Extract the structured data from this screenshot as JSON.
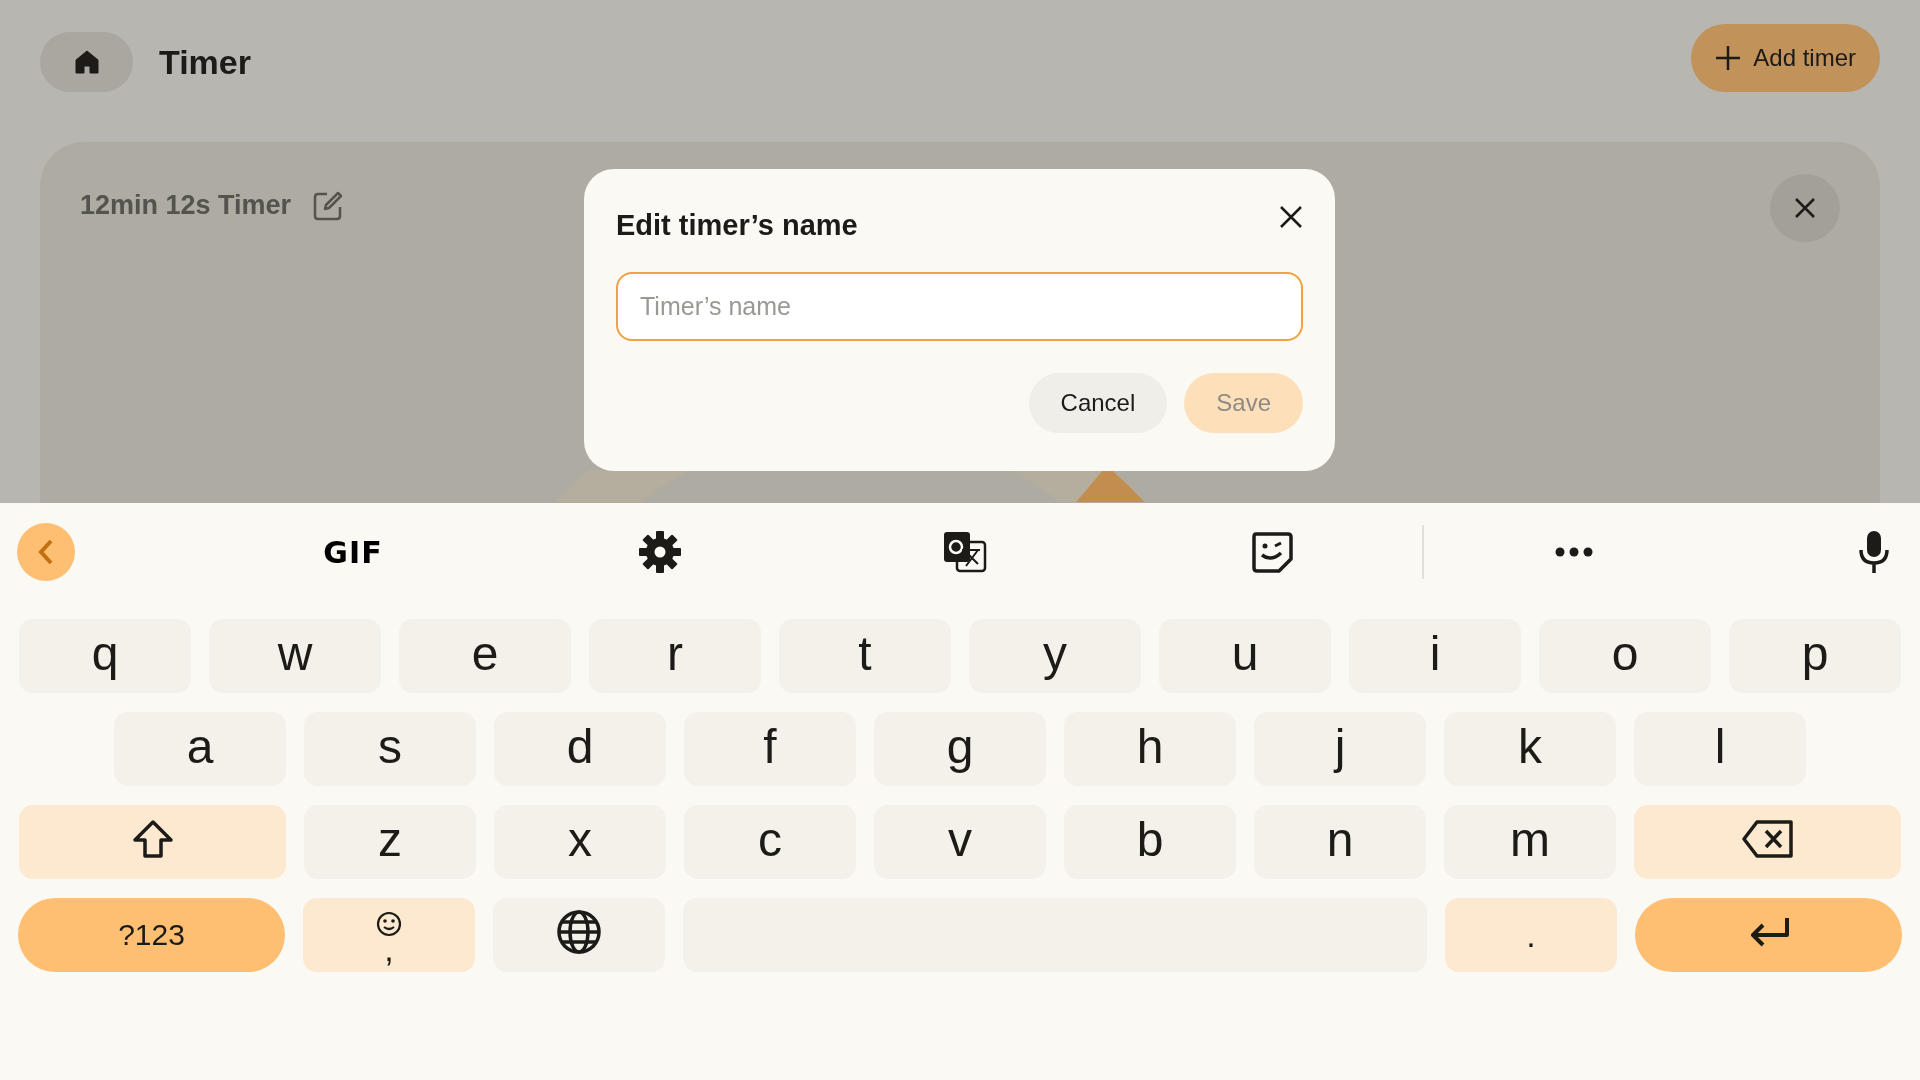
{
  "header": {
    "title": "Timer",
    "add_button": "Add timer"
  },
  "timer_card": {
    "title": "12min 12s Timer"
  },
  "dialog": {
    "title": "Edit timer’s name",
    "input": {
      "placeholder": "Timer’s name"
    },
    "buttons": [
      {
        "label": "Cancel",
        "kind": "secondary",
        "disabled": false
      },
      {
        "label": "Save",
        "kind": "primary",
        "disabled": true
      }
    ]
  },
  "keyboard": {
    "toolbar": [
      {
        "kind": "back"
      },
      {
        "kind": "gif",
        "label": "GIF"
      },
      {
        "kind": "settings"
      },
      {
        "kind": "translate"
      },
      {
        "kind": "sticker"
      },
      {
        "kind": "divider"
      },
      {
        "kind": "more"
      },
      {
        "kind": "mic"
      }
    ],
    "letter_rows": [
      [
        {
          "kind": "letter",
          "label": "q"
        },
        {
          "kind": "letter",
          "label": "w"
        },
        {
          "kind": "letter",
          "label": "e"
        },
        {
          "kind": "letter",
          "label": "r"
        },
        {
          "kind": "letter",
          "label": "t"
        },
        {
          "kind": "letter",
          "label": "y"
        },
        {
          "kind": "letter",
          "label": "u"
        },
        {
          "kind": "letter",
          "label": "i"
        },
        {
          "kind": "letter",
          "label": "o"
        },
        {
          "kind": "letter",
          "label": "p"
        }
      ],
      [
        {
          "kind": "letter",
          "label": "a"
        },
        {
          "kind": "letter",
          "label": "s"
        },
        {
          "kind": "letter",
          "label": "d"
        },
        {
          "kind": "letter",
          "label": "f"
        },
        {
          "kind": "letter",
          "label": "g"
        },
        {
          "kind": "letter",
          "label": "h"
        },
        {
          "kind": "letter",
          "label": "j"
        },
        {
          "kind": "letter",
          "label": "k"
        },
        {
          "kind": "letter",
          "label": "l"
        }
      ],
      [
        {
          "kind": "shift"
        },
        {
          "kind": "letter",
          "label": "z"
        },
        {
          "kind": "letter",
          "label": "x"
        },
        {
          "kind": "letter",
          "label": "c"
        },
        {
          "kind": "letter",
          "label": "v"
        },
        {
          "kind": "letter",
          "label": "b"
        },
        {
          "kind": "letter",
          "label": "n"
        },
        {
          "kind": "letter",
          "label": "m"
        },
        {
          "kind": "backspace"
        }
      ]
    ],
    "bottom_row": {
      "symbols_key": "?123",
      "comma_key": ",",
      "period_key": "."
    }
  }
}
